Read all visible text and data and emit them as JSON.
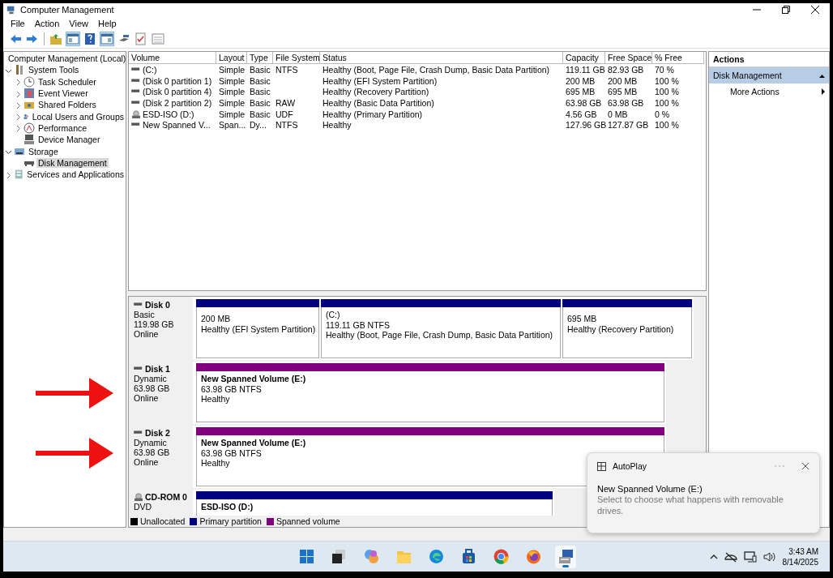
{
  "window": {
    "title": "Computer Management"
  },
  "menu": [
    "File",
    "Action",
    "View",
    "Help"
  ],
  "toolbar": [
    {
      "kind": "back",
      "on": false
    },
    {
      "kind": "forward",
      "on": false
    },
    {
      "kind": "up",
      "on": false
    },
    {
      "kind": "tree",
      "on": true
    },
    {
      "kind": "help",
      "on": false
    },
    {
      "kind": "pane",
      "on": true
    },
    {
      "kind": "connect",
      "on": false
    },
    {
      "kind": "check",
      "on": false
    },
    {
      "kind": "list",
      "on": false
    }
  ],
  "tree": [
    {
      "label": "Computer Management (Local)",
      "kind": "computer",
      "selected": false,
      "children": [
        {
          "label": "System Tools",
          "kind": "tools",
          "expanded": true,
          "selected": false,
          "children": [
            {
              "label": "Task Scheduler",
              "kind": "clock",
              "expanded": false,
              "selected": false
            },
            {
              "label": "Event Viewer",
              "kind": "viewer",
              "expanded": false,
              "selected": false
            },
            {
              "label": "Shared Folders",
              "kind": "share",
              "expanded": false,
              "selected": false
            },
            {
              "label": "Local Users and Groups",
              "kind": "users",
              "expanded": false,
              "selected": false
            },
            {
              "label": "Performance",
              "kind": "perf",
              "expanded": false,
              "selected": false
            },
            {
              "label": "Device Manager",
              "kind": "device",
              "selected": false
            }
          ]
        },
        {
          "label": "Storage",
          "kind": "storage",
          "expanded": true,
          "selected": false,
          "children": [
            {
              "label": "Disk Management",
              "kind": "disk",
              "selected": true
            }
          ]
        },
        {
          "label": "Services and Applications",
          "kind": "services",
          "expanded": false,
          "selected": false
        }
      ]
    }
  ],
  "volumes": {
    "columns": [
      "Volume",
      "Layout",
      "Type",
      "File System",
      "Status",
      "Capacity",
      "Free Space",
      "% Free"
    ],
    "rows": [
      {
        "kind": "disk",
        "cells": [
          "(C:)",
          "Simple",
          "Basic",
          "NTFS",
          "Healthy (Boot, Page File, Crash Dump, Basic Data Partition)",
          "119.11 GB",
          "82.93 GB",
          "70 %"
        ]
      },
      {
        "kind": "disk",
        "cells": [
          "(Disk 0 partition 1)",
          "Simple",
          "Basic",
          "",
          "Healthy (EFI System Partition)",
          "200 MB",
          "200 MB",
          "100 %"
        ]
      },
      {
        "kind": "disk",
        "cells": [
          "(Disk 0 partition 4)",
          "Simple",
          "Basic",
          "",
          "Healthy (Recovery Partition)",
          "695 MB",
          "695 MB",
          "100 %"
        ]
      },
      {
        "kind": "disk",
        "cells": [
          "(Disk 2 partition 2)",
          "Simple",
          "Basic",
          "RAW",
          "Healthy (Basic Data Partition)",
          "63.98 GB",
          "63.98 GB",
          "100 %"
        ]
      },
      {
        "kind": "cdrom",
        "cells": [
          "ESD-ISO (D:)",
          "Simple",
          "Basic",
          "UDF",
          "Healthy (Primary Partition)",
          "4.56 GB",
          "0 MB",
          "0 %"
        ]
      },
      {
        "kind": "disk",
        "cells": [
          "New Spanned V...",
          "Span...",
          "Dy...",
          "NTFS",
          "Healthy",
          "127.96 GB",
          "127.87 GB",
          "100 %"
        ]
      }
    ]
  },
  "disks": [
    {
      "kind": "disk",
      "name": "Disk 0",
      "info": [
        "Basic",
        "119.98 GB",
        "Online"
      ],
      "marked": false,
      "partitions": [
        {
          "kind": "primary",
          "lines": [
            "200 MB",
            "Healthy (EFI System Partition)"
          ]
        },
        {
          "kind": "primary",
          "lines": [
            "(C:)",
            "119.11 GB NTFS",
            "Healthy (Boot, Page File, Crash Dump, Basic Data Partition)"
          ]
        },
        {
          "kind": "primary",
          "lines": [
            "695 MB",
            "Healthy (Recovery Partition)"
          ]
        }
      ]
    },
    {
      "kind": "disk",
      "name": "Disk 1",
      "info": [
        "Dynamic",
        "63.98 GB",
        "Online"
      ],
      "marked": true,
      "partitions": [
        {
          "kind": "spanned",
          "title": "New Spanned Volume  (E:)",
          "lines": [
            "63.98 GB NTFS",
            "Healthy"
          ]
        }
      ]
    },
    {
      "kind": "disk",
      "name": "Disk 2",
      "info": [
        "Dynamic",
        "63.98 GB",
        "Online"
      ],
      "marked": true,
      "partitions": [
        {
          "kind": "spanned",
          "title": "New Spanned Volume  (E:)",
          "lines": [
            "63.98 GB NTFS",
            "Healthy"
          ]
        }
      ]
    },
    {
      "kind": "cdrom",
      "name": "CD-ROM 0",
      "info": [
        "DVD"
      ],
      "marked": false,
      "partitions": [
        {
          "kind": "primary",
          "title": "ESD-ISO  (D:)"
        }
      ]
    }
  ],
  "legend": [
    {
      "label": "Unallocated",
      "color": "#000000"
    },
    {
      "label": "Primary partition",
      "color": "#000080"
    },
    {
      "label": "Spanned volume",
      "color": "#800080"
    }
  ],
  "actions": {
    "title": "Actions",
    "section": "Disk Management",
    "items": [
      "More Actions"
    ]
  },
  "notification": {
    "app": "AutoPlay",
    "title": "New Spanned Volume (E:)",
    "body": "Select to choose what happens with removable drives."
  },
  "taskbar": {
    "apps": [
      {
        "kind": "start",
        "selected": false
      },
      {
        "kind": "taskview",
        "selected": false
      },
      {
        "kind": "swirl",
        "selected": false
      },
      {
        "kind": "folder",
        "selected": false
      },
      {
        "kind": "wave",
        "selected": false
      },
      {
        "kind": "store",
        "selected": false
      },
      {
        "kind": "ring",
        "selected": false
      },
      {
        "kind": "flame",
        "selected": false
      },
      {
        "kind": "computer",
        "selected": true
      }
    ],
    "time": "3:43 AM",
    "date": "8/14/2025"
  }
}
